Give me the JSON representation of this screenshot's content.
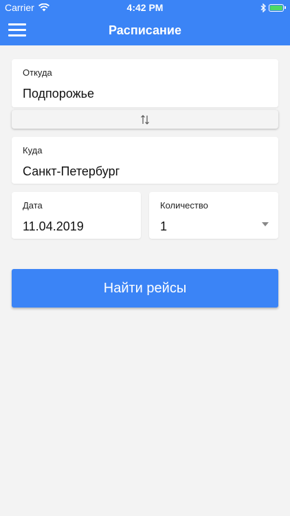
{
  "status_bar": {
    "carrier": "Carrier",
    "time": "4:42 PM",
    "battery_color": "#4cd964"
  },
  "navbar": {
    "title": "Расписание",
    "menu_icon": "hamburger-menu-icon",
    "background": "#3b84f6"
  },
  "form": {
    "from": {
      "label": "Откуда",
      "value": "Подпорожье"
    },
    "swap": {
      "icon": "swap-vertical-icon"
    },
    "to": {
      "label": "Куда",
      "value": "Санкт-Петербург"
    },
    "date": {
      "label": "Дата",
      "value": "11.04.2019"
    },
    "count": {
      "label": "Количество",
      "value": "1"
    },
    "search_label": "Найти рейсы"
  }
}
